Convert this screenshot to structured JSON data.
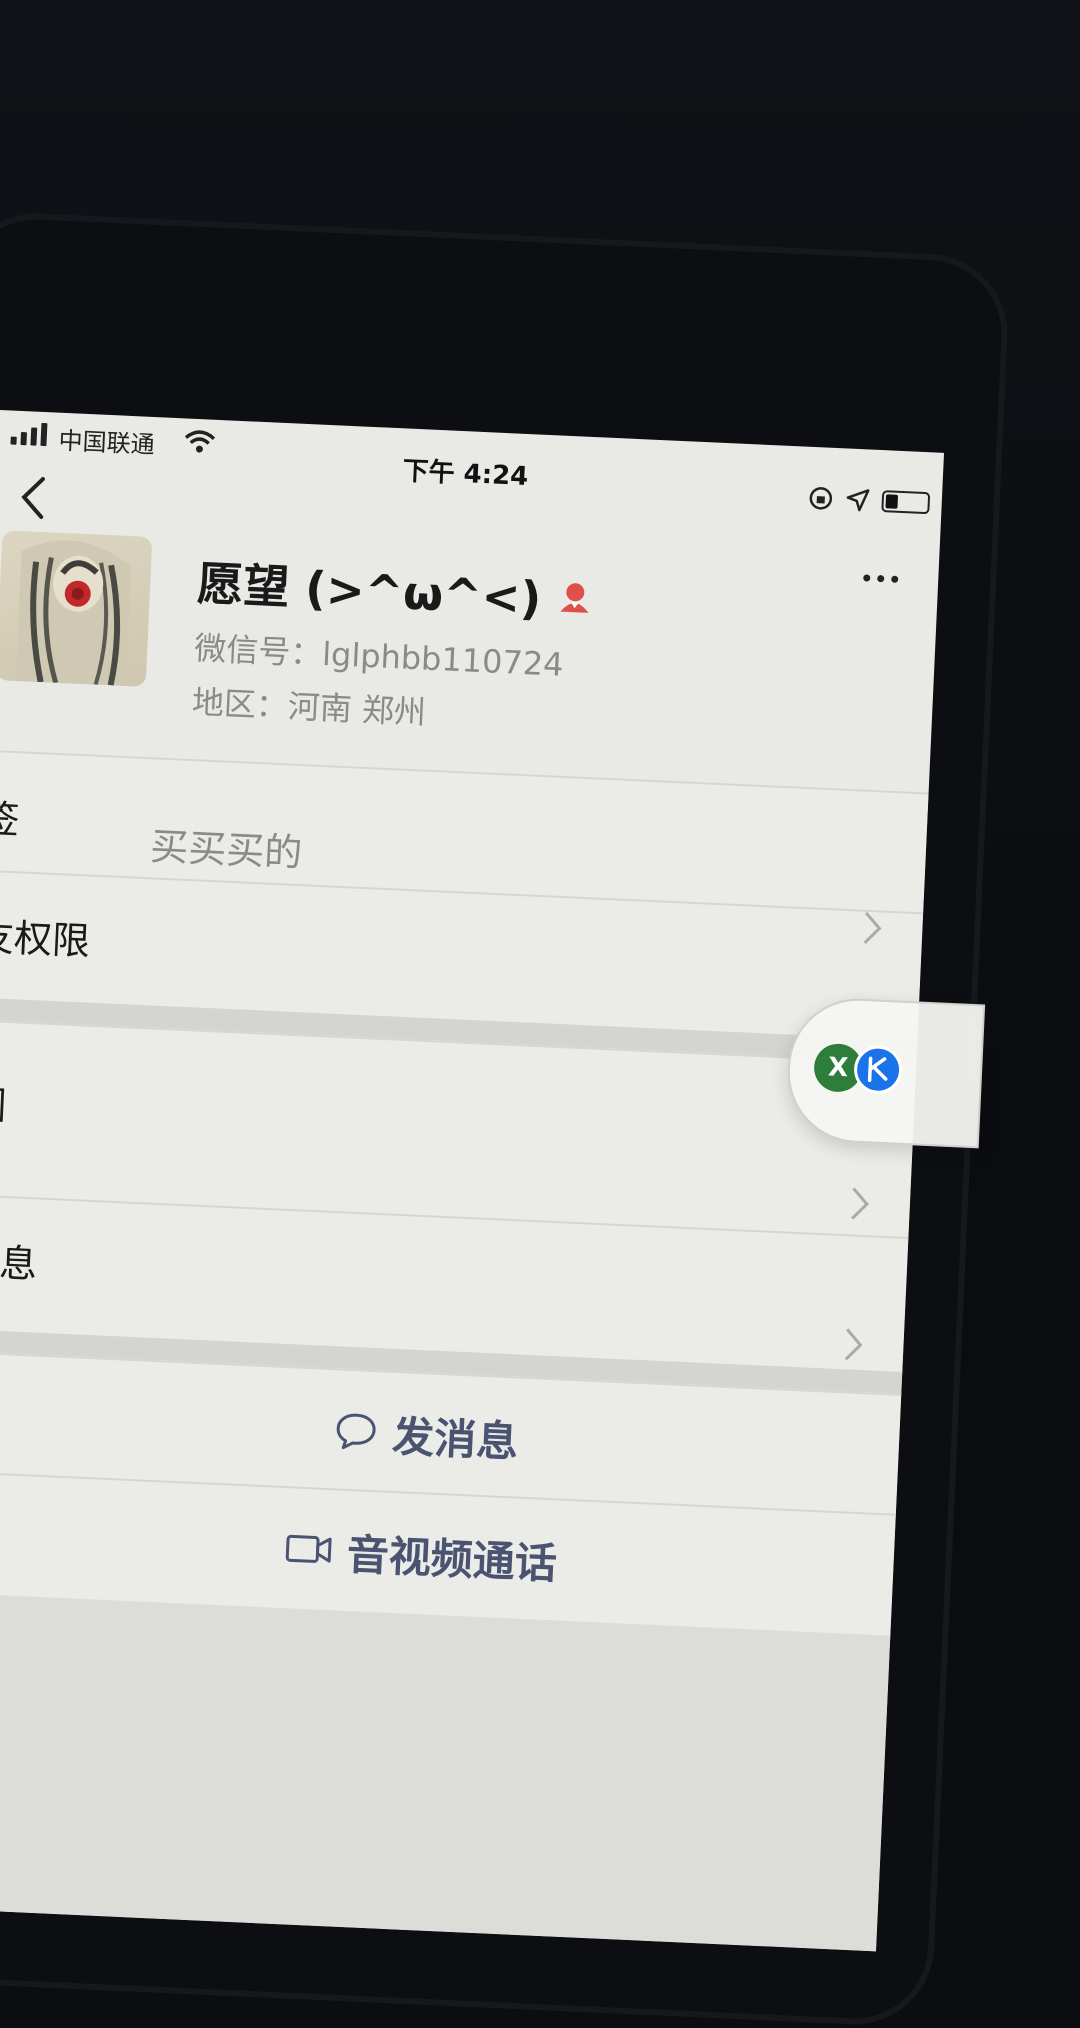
{
  "statusbar": {
    "carrier": "中国联通",
    "time": "下午 4:24",
    "battery_level": 0.3
  },
  "profile": {
    "nickname": "愿望 (>^ω^<)",
    "wechat_id": "微信号：lglphbb110724",
    "region": "地区：河南 郑州"
  },
  "rows": {
    "tag_label": "签",
    "tag_value": "买买买的",
    "permission_label": "友权限",
    "moments_label": "圈",
    "more_info_label": "信息"
  },
  "actions": {
    "send_message": "发消息",
    "video_call": "音视频通话"
  },
  "float": {
    "badge_letter": "X"
  },
  "colors": {
    "screen_bg": "#e9e9e6",
    "action_text": "#4a5370",
    "gender_icon": "#e0504a",
    "float_green": "#2e7d3a",
    "float_blue": "#1a73e8"
  }
}
